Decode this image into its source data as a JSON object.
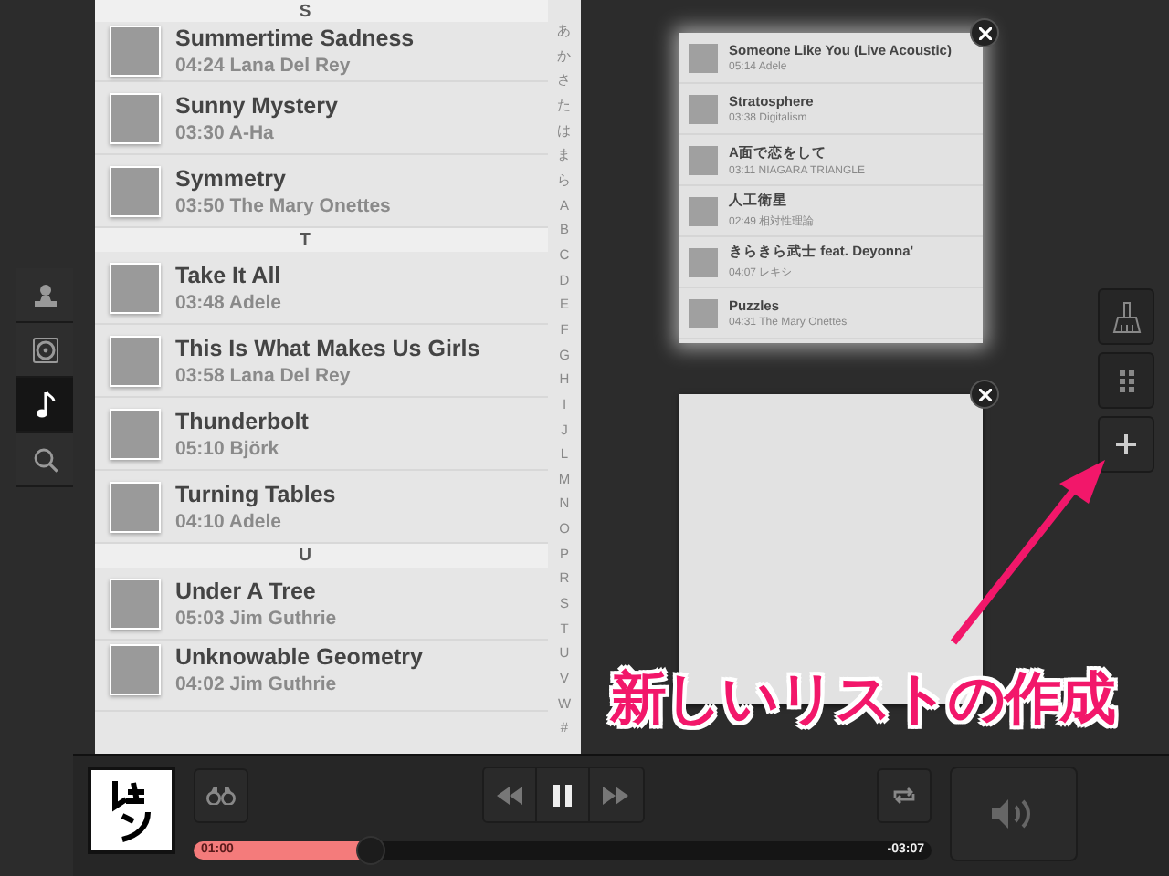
{
  "nav": [
    {
      "kind": "person",
      "selected": false
    },
    {
      "kind": "disc",
      "selected": false
    },
    {
      "kind": "note",
      "selected": true
    },
    {
      "kind": "search",
      "selected": false
    }
  ],
  "library": {
    "sticky_header": "S",
    "items": [
      {
        "kind": "track",
        "title": "Summertime Sadness",
        "subtitle": "04:24 Lana Del Rey"
      },
      {
        "kind": "track",
        "title": "Sunny Mystery",
        "subtitle": "03:30 A-Ha"
      },
      {
        "kind": "track",
        "title": "Symmetry",
        "subtitle": "03:50 The Mary Onettes"
      },
      {
        "kind": "header",
        "label": "T"
      },
      {
        "kind": "track",
        "title": "Take It All",
        "subtitle": "03:48 Adele"
      },
      {
        "kind": "track",
        "title": "This Is What Makes Us Girls",
        "subtitle": "03:58 Lana Del Rey"
      },
      {
        "kind": "track",
        "title": "Thunderbolt",
        "subtitle": "05:10 Björk"
      },
      {
        "kind": "track",
        "title": "Turning Tables",
        "subtitle": "04:10 Adele"
      },
      {
        "kind": "header",
        "label": "U"
      },
      {
        "kind": "track",
        "title": "Under A Tree",
        "subtitle": "05:03 Jim Guthrie"
      },
      {
        "kind": "track",
        "title": "Unknowable Geometry",
        "subtitle": "04:02 Jim Guthrie"
      }
    ],
    "index": [
      "あ",
      "か",
      "さ",
      "た",
      "は",
      "ま",
      "ら",
      "A",
      "B",
      "C",
      "D",
      "E",
      "F",
      "G",
      "H",
      "I",
      "J",
      "L",
      "M",
      "N",
      "O",
      "P",
      "R",
      "S",
      "T",
      "U",
      "V",
      "W",
      "#"
    ]
  },
  "playlists": [
    {
      "kind": "list",
      "tracks": [
        {
          "title": "Someone Like You (Live Acoustic)",
          "subtitle": "05:14 Adele"
        },
        {
          "title": "Stratosphere",
          "subtitle": "03:38 Digitalism"
        },
        {
          "title": "A面で恋をして",
          "subtitle": "03:11 NIAGARA TRIANGLE"
        },
        {
          "title": "人工衛星",
          "subtitle": "02:49 相対性理論"
        },
        {
          "title": "きらきら武士 feat. Deyonna'",
          "subtitle": "04:07 レキシ"
        },
        {
          "title": "Puzzles",
          "subtitle": "04:31 The Mary Onettes"
        }
      ]
    },
    {
      "kind": "empty"
    }
  ],
  "toolbar": [
    {
      "kind": "sweep"
    },
    {
      "kind": "grid"
    },
    {
      "kind": "add"
    }
  ],
  "annotation": {
    "text": "新しいリストの作成"
  },
  "player": {
    "playing": true,
    "elapsed": "01:00",
    "remaining": "-03:07",
    "level": 0.24
  }
}
